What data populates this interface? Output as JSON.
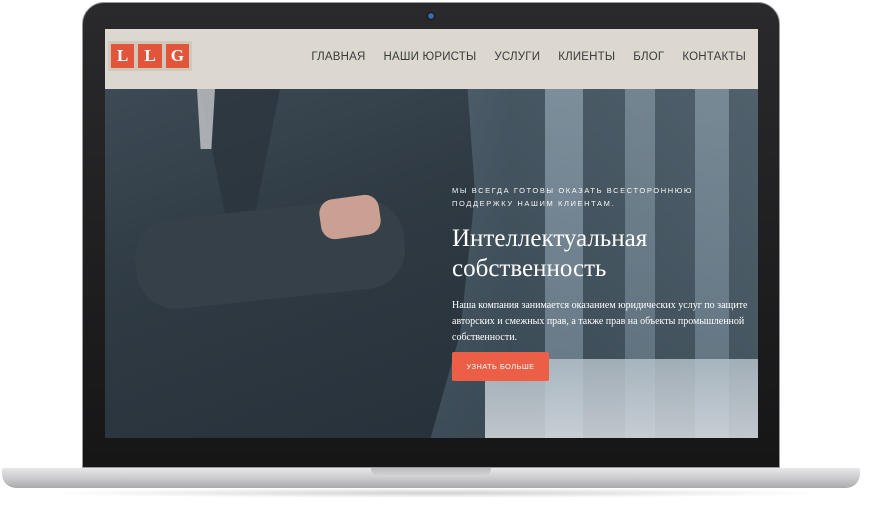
{
  "brand": {
    "logo_letters": [
      "L",
      "L",
      "G"
    ]
  },
  "nav": {
    "items": [
      {
        "label": "ГЛАВНАЯ"
      },
      {
        "label": "НАШИ ЮРИСТЫ"
      },
      {
        "label": "УСЛУГИ"
      },
      {
        "label": "КЛИЕНТЫ"
      },
      {
        "label": "БЛОГ"
      },
      {
        "label": "КОНТАКТЫ"
      }
    ]
  },
  "hero": {
    "eyebrow": "Мы всегда готовы оказать всестороннюю поддержку нашим клиентам.",
    "headline_line1": "Интеллектуальная",
    "headline_line2": "собственность",
    "description": "Наша компания занимается оказанием юридических услуг по защите авторских и смежных прав, а также прав на объекты промышленной собственности.",
    "cta_label": "УЗНАТЬ БОЛЬШЕ"
  },
  "colors": {
    "accent": "#ec5e46",
    "nav_bg": "#dcd8cf",
    "logo_tile": "#e2553a"
  }
}
